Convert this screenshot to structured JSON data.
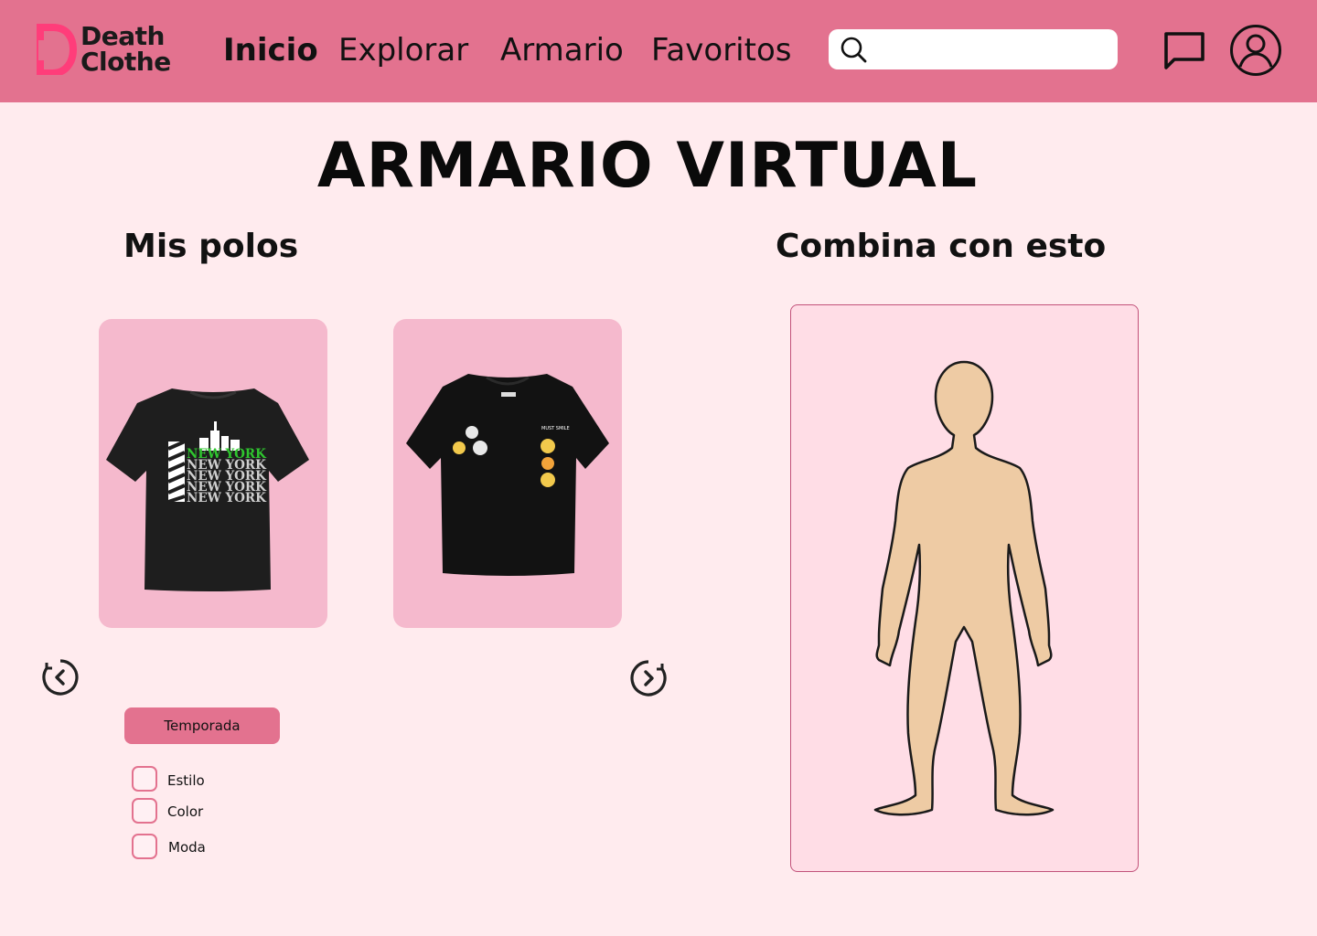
{
  "brand": {
    "line1": "Death",
    "line2": "Clothe",
    "logo_color": "#ff3d7a"
  },
  "nav": {
    "items": [
      {
        "label": "Inicio",
        "active": true
      },
      {
        "label": "Explorar",
        "active": false
      },
      {
        "label": "Armario",
        "active": false
      },
      {
        "label": "Favoritos",
        "active": false
      }
    ]
  },
  "search": {
    "placeholder": "",
    "value": ""
  },
  "header_icons": {
    "chat": "chat-icon",
    "profile": "user-icon"
  },
  "page": {
    "title": "ARMARIO VIRTUAL"
  },
  "wardrobe": {
    "title": "Mis polos",
    "items": [
      {
        "name": "new-york-tshirt",
        "print_lines": [
          "NEW YORK",
          "NEW YORK",
          "NEW YORK",
          "NEW YORK",
          "NEW YORK"
        ]
      },
      {
        "name": "emoji-tshirt",
        "print_text": "MUST SMILE"
      }
    ],
    "prev_icon": "chevron-left-circle-icon",
    "next_icon": "chevron-right-circle-icon"
  },
  "filters": {
    "button_label": "Temporada",
    "options": [
      {
        "label": "Estilo",
        "checked": false
      },
      {
        "label": "Color",
        "checked": false
      },
      {
        "label": "Moda",
        "checked": false
      }
    ]
  },
  "match": {
    "title": "Combina con esto",
    "figure": "mannequin"
  },
  "colors": {
    "header": "#e3728f",
    "background": "#ffebee",
    "card": "#f5b9cd",
    "panel": "#ffdde6",
    "skin": "#eecba4"
  }
}
